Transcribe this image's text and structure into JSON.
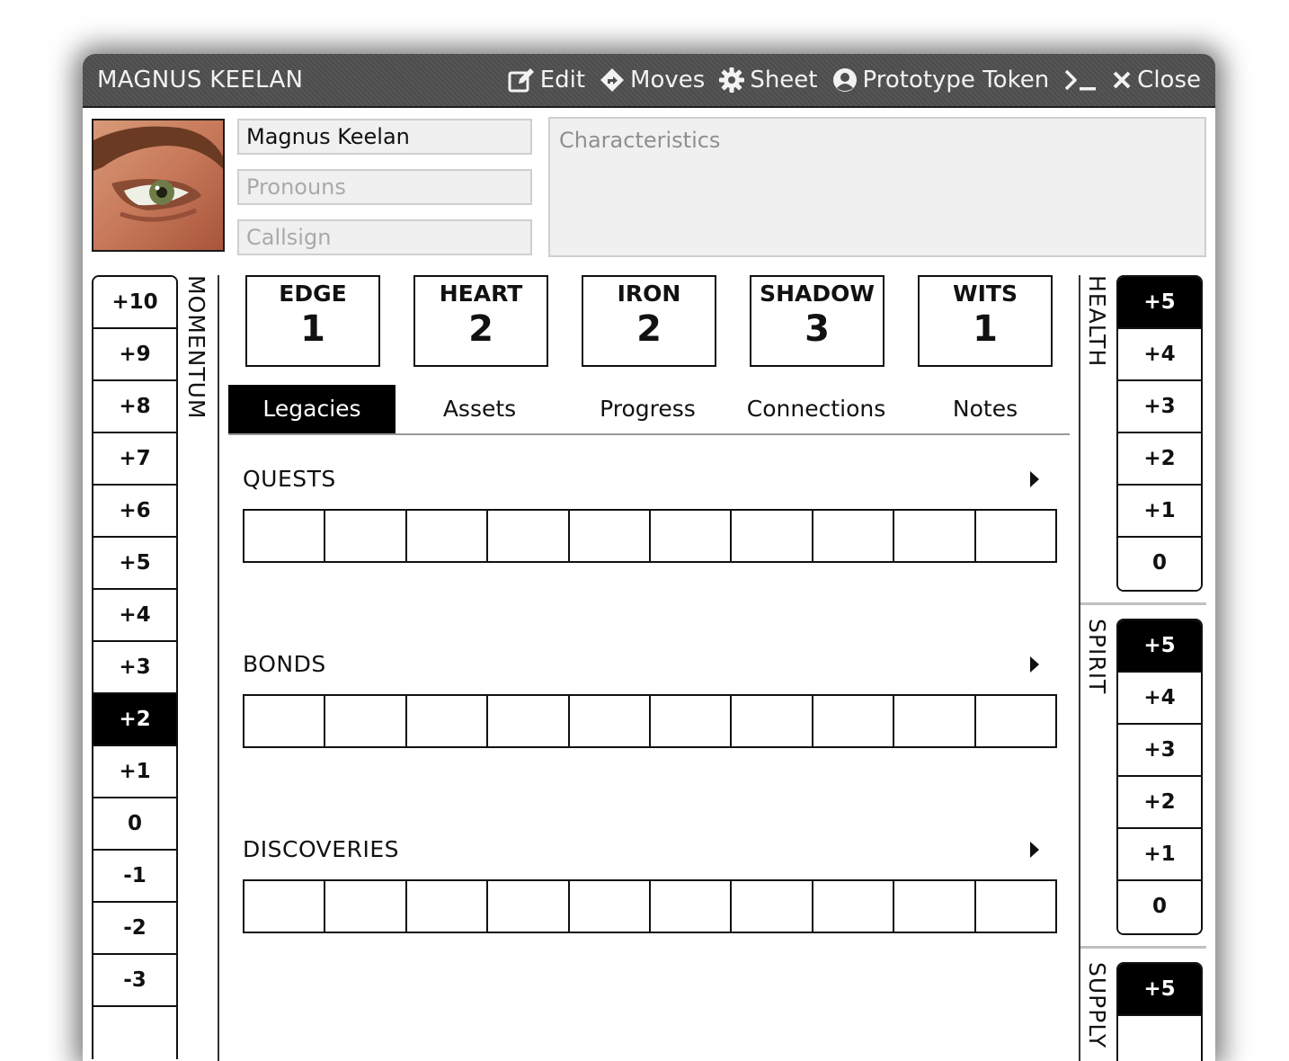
{
  "window": {
    "title": "MAGNUS KEELAN",
    "controls": [
      {
        "label": "Edit",
        "icon": "edit-icon"
      },
      {
        "label": "Moves",
        "icon": "moves-icon"
      },
      {
        "label": "Sheet",
        "icon": "gear-icon"
      },
      {
        "label": "Prototype Token",
        "icon": "user-circle-icon"
      },
      {
        "label": "",
        "icon": "terminal-icon"
      },
      {
        "label": "Close",
        "icon": "close-icon"
      }
    ]
  },
  "profile": {
    "name": "Magnus Keelan",
    "pronouns_placeholder": "Pronouns",
    "callsign_placeholder": "Callsign",
    "characteristics_placeholder": "Characteristics"
  },
  "momentum": {
    "label": "MOMENTUM",
    "values": [
      "+10",
      "+9",
      "+8",
      "+7",
      "+6",
      "+5",
      "+4",
      "+3",
      "+2",
      "+1",
      "0",
      "-1",
      "-2",
      "-3"
    ],
    "current": "+2"
  },
  "stats": [
    {
      "name": "EDGE",
      "value": "1"
    },
    {
      "name": "HEART",
      "value": "2"
    },
    {
      "name": "IRON",
      "value": "2"
    },
    {
      "name": "SHADOW",
      "value": "3"
    },
    {
      "name": "WITS",
      "value": "1"
    }
  ],
  "tabs": [
    "Legacies",
    "Assets",
    "Progress",
    "Connections",
    "Notes"
  ],
  "active_tab": "Legacies",
  "legacies": [
    {
      "title": "QUESTS",
      "boxes_filled": 0
    },
    {
      "title": "BONDS",
      "boxes_filled": 0
    },
    {
      "title": "DISCOVERIES",
      "boxes_filled": 0
    }
  ],
  "meters": {
    "health": {
      "label": "HEALTH",
      "values": [
        "+5",
        "+4",
        "+3",
        "+2",
        "+1",
        "0"
      ],
      "current": "+5"
    },
    "spirit": {
      "label": "SPIRIT",
      "values": [
        "+5",
        "+4",
        "+3",
        "+2",
        "+1",
        "0"
      ],
      "current": "+5"
    },
    "supply": {
      "label": "SUPPLY",
      "values": [
        "+5"
      ],
      "current": "+5"
    }
  },
  "colors": {
    "titlebar": "#4f4f4f",
    "active": "#000000",
    "field_bg": "#f0f0f0"
  }
}
